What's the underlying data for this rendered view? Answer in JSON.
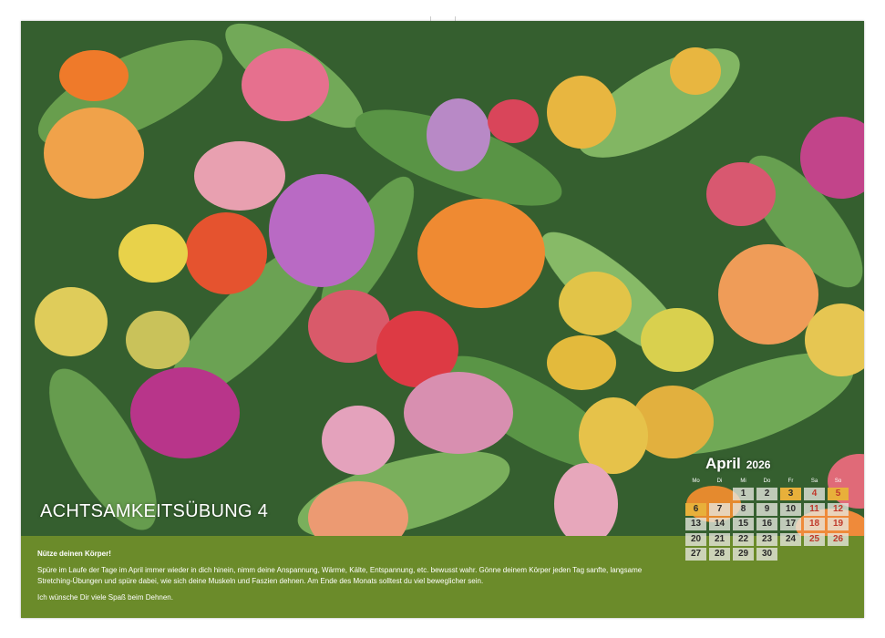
{
  "page": {
    "title": "ACHTSAMKEITSÜBUNG 4",
    "text": {
      "heading": "Nütze deinen Körper!",
      "body": "Spüre im Laufe der Tage im April immer wieder in dich hinein, nimm deine Anspannung, Wärme, Kälte, Entspannung, etc. bewusst wahr. Gönne deinem Körper jeden Tag sanfte, langsame Stretching-Übungen und spüre dabei, wie sich deine Muskeln und Faszien dehnen. Am Ende des Monats solltest du viel beweglicher sein.",
      "closing": "Ich wünsche Dir viele Spaß beim Dehnen."
    },
    "colors": {
      "background_green": "#6b8b2a",
      "weekend_red": "#c0392b"
    }
  },
  "calendar": {
    "month": "April",
    "year": "2026",
    "weekdays": [
      "Mo",
      "Di",
      "Mi",
      "Do",
      "Fr",
      "Sa",
      "So"
    ],
    "weeks": [
      [
        "",
        "",
        "1",
        "2",
        "3",
        "4",
        "5"
      ],
      [
        "6",
        "7",
        "8",
        "9",
        "10",
        "11",
        "12"
      ],
      [
        "13",
        "14",
        "15",
        "16",
        "17",
        "18",
        "19"
      ],
      [
        "20",
        "21",
        "22",
        "23",
        "24",
        "25",
        "26"
      ],
      [
        "27",
        "28",
        "29",
        "30",
        "",
        "",
        ""
      ]
    ],
    "highlighted_dates": [
      "3",
      "5",
      "6"
    ]
  }
}
